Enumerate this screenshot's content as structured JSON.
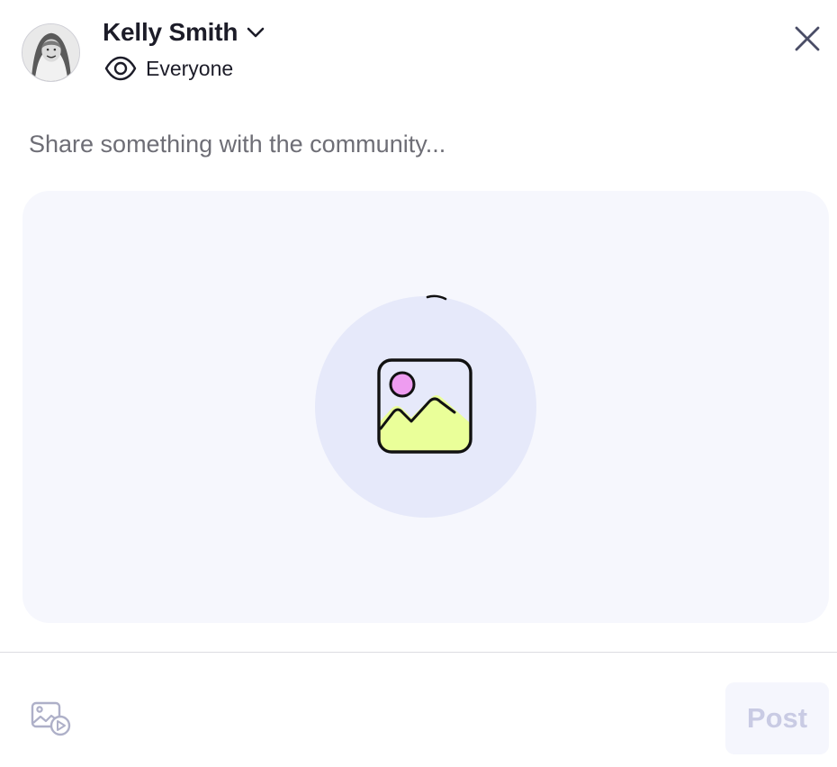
{
  "header": {
    "user_name": "Kelly Smith",
    "audience_label": "Everyone"
  },
  "composer": {
    "placeholder": "Share something with the community..."
  },
  "footer": {
    "post_label": "Post"
  },
  "icons": {
    "avatar": "avatar",
    "chevron": "chevron-down-icon",
    "eye": "eye-icon",
    "close": "close-icon",
    "image": "image-icon",
    "add_media": "add-media-icon"
  },
  "colors": {
    "text": "#1c1c28",
    "placeholder": "#6e6e76",
    "dropzone_bg": "#f6f7fd",
    "circle_bg": "#e6e9fa",
    "image_sun": "#ee9cf0",
    "image_mountain": "#eaff99",
    "post_disabled_text": "#c9cbe4",
    "post_disabled_bg": "#f5f6fd"
  }
}
